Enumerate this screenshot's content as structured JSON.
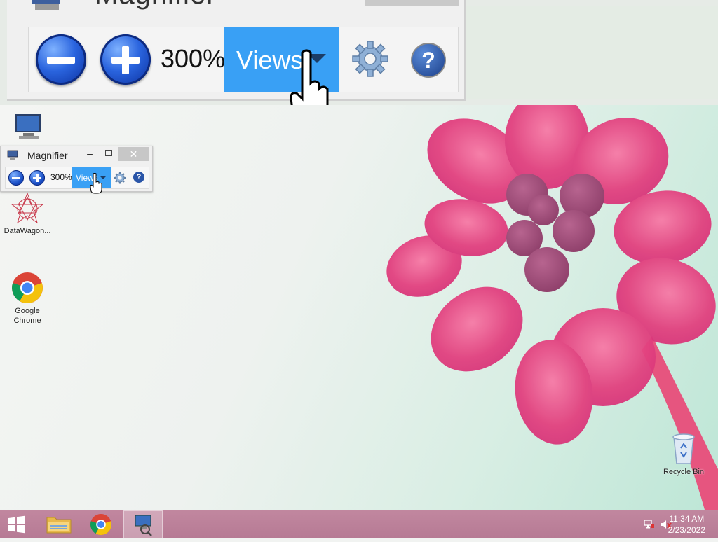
{
  "magnifier": {
    "title": "Magnifier",
    "zoom": "300%",
    "views_label": "Views",
    "minimize": "–",
    "close": "✕",
    "help": "?",
    "icons": [
      "zoom-out-icon",
      "zoom-in-icon",
      "gear-icon",
      "help-icon"
    ]
  },
  "lens": {
    "title": "Magnifier",
    "zoom": "300%",
    "views_label": "Views",
    "help": "?"
  },
  "desktop": {
    "icons": [
      {
        "name": "computer-icon",
        "label": ""
      },
      {
        "name": "datawagon-icon",
        "label": "DataWagon..."
      },
      {
        "name": "chrome-icon",
        "label": "Google Chrome"
      },
      {
        "name": "recycle-bin-icon",
        "label": "Recycle Bin"
      }
    ]
  },
  "taskbar": {
    "time": "11:34 AM",
    "date": "2/23/2022",
    "items": [
      "start",
      "file-explorer",
      "google-chrome",
      "magnifier"
    ]
  },
  "colors": {
    "accent_blue": "#39a0f5",
    "taskbar": "#b67a94",
    "flower_pink": "#e2417f"
  }
}
